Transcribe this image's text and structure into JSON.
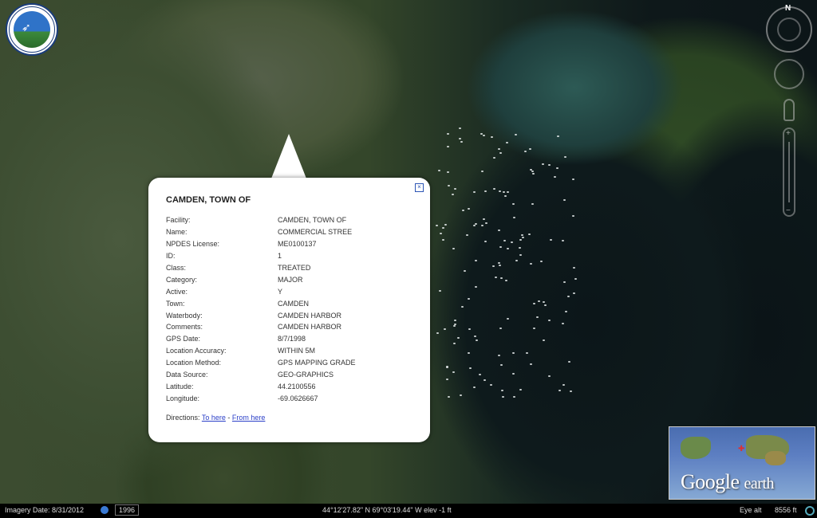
{
  "logo": {
    "alt": "DEPARTMENT OF ENVIRONMENTAL PROTECTION STATE OF MAINE"
  },
  "compass": {
    "north": "N"
  },
  "popup": {
    "title": "CAMDEN, TOWN OF",
    "close_icon": "close-icon",
    "fields": [
      {
        "label": "Facility:",
        "value": "CAMDEN, TOWN OF"
      },
      {
        "label": "Name:",
        "value": "COMMERCIAL STREE"
      },
      {
        "label": "NPDES License:",
        "value": "ME0100137"
      },
      {
        "label": "ID:",
        "value": "1"
      },
      {
        "label": "Class:",
        "value": "TREATED"
      },
      {
        "label": "Category:",
        "value": "MAJOR"
      },
      {
        "label": "Active:",
        "value": "Y"
      },
      {
        "label": "Town:",
        "value": "CAMDEN"
      },
      {
        "label": "Waterbody:",
        "value": "CAMDEN HARBOR"
      },
      {
        "label": "Comments:",
        "value": "CAMDEN HARBOR"
      },
      {
        "label": "GPS Date:",
        "value": "8/7/1998"
      },
      {
        "label": "Location Accuracy:",
        "value": "WITHIN 5M"
      },
      {
        "label": "Location Method:",
        "value": "GPS MAPPING GRADE"
      },
      {
        "label": "Data Source:",
        "value": "GEO-GRAPHICS"
      },
      {
        "label": "Latitude:",
        "value": "44.2100556"
      },
      {
        "label": "Longitude:",
        "value": "-69.0626667"
      }
    ],
    "directions_label": "Directions:",
    "to_here": "To here",
    "separator": "-",
    "from_here": "From here"
  },
  "overview": {
    "brand": "Google",
    "brand_suffix": "earth"
  },
  "status": {
    "imagery_date": "Imagery Date: 8/31/2012",
    "year": "1996",
    "coords": "44°12'27.82\" N  69°03'19.44\" W  elev   -1 ft",
    "eye_alt_label": "Eye alt",
    "eye_alt_value": "8556 ft"
  }
}
